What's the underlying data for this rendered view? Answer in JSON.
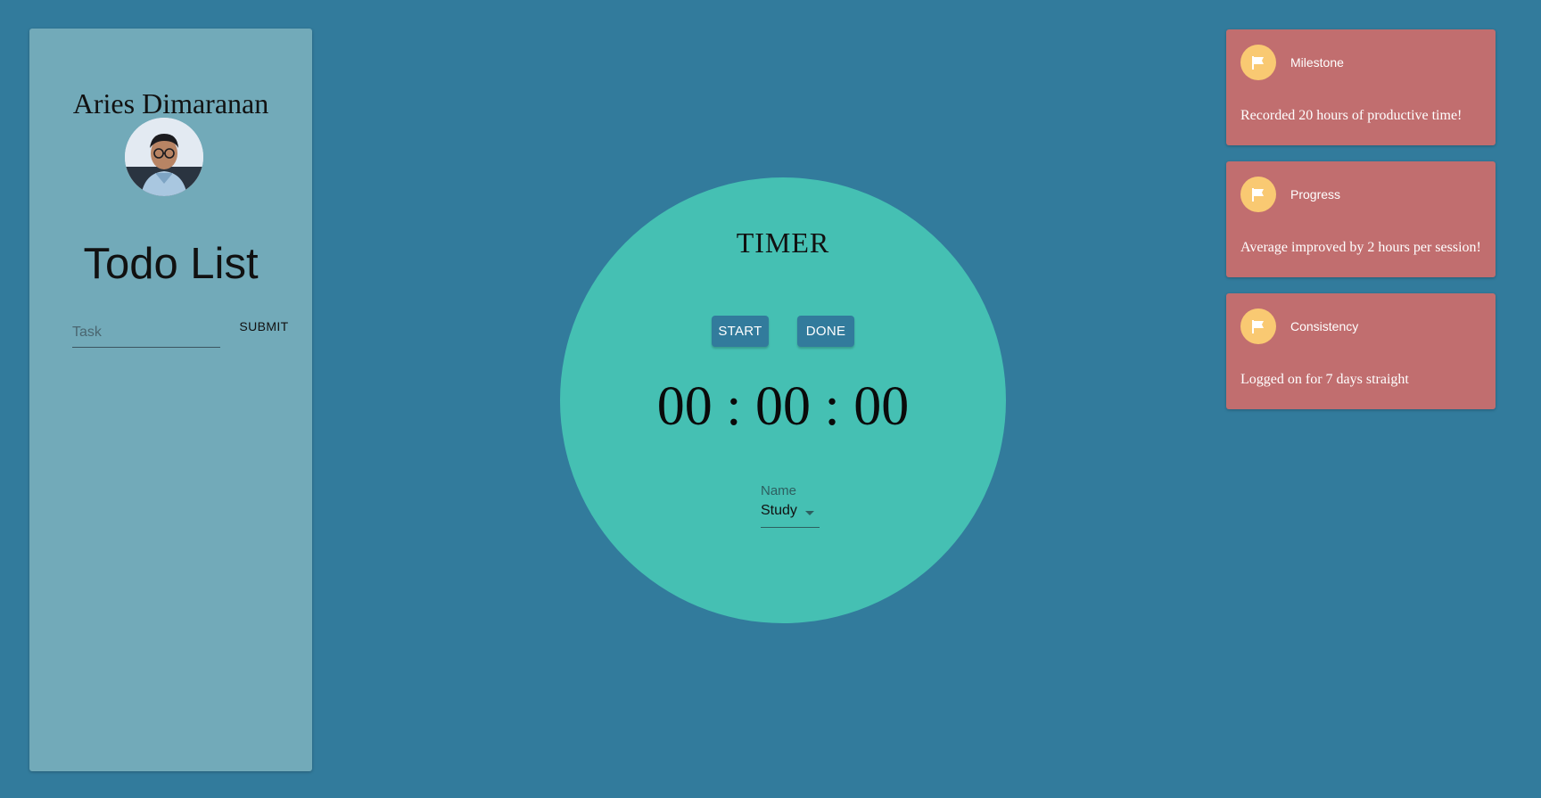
{
  "colors": {
    "background": "#327b9c",
    "sidebar": "#72aab9",
    "timer_circle": "#45c0b3",
    "card": "#c16e6f",
    "card_icon": "#f9c972",
    "button": "#327b9c"
  },
  "sidebar": {
    "user_name": "Aries Dimaranan",
    "title": "Todo List",
    "task_placeholder": "Task",
    "submit_label": "SUBMIT"
  },
  "timer": {
    "title": "TIMER",
    "start_label": "START",
    "done_label": "DONE",
    "display": "00 : 00 : 00",
    "name_label": "Name",
    "name_value": "Study"
  },
  "cards": [
    {
      "icon": "flag-icon",
      "title": "Milestone",
      "text": "Recorded 20 hours of productive time!"
    },
    {
      "icon": "flag-icon",
      "title": "Progress",
      "text": "Average improved by 2 hours per session!"
    },
    {
      "icon": "flag-icon",
      "title": "Consistency",
      "text": "Logged on for 7 days straight"
    }
  ]
}
